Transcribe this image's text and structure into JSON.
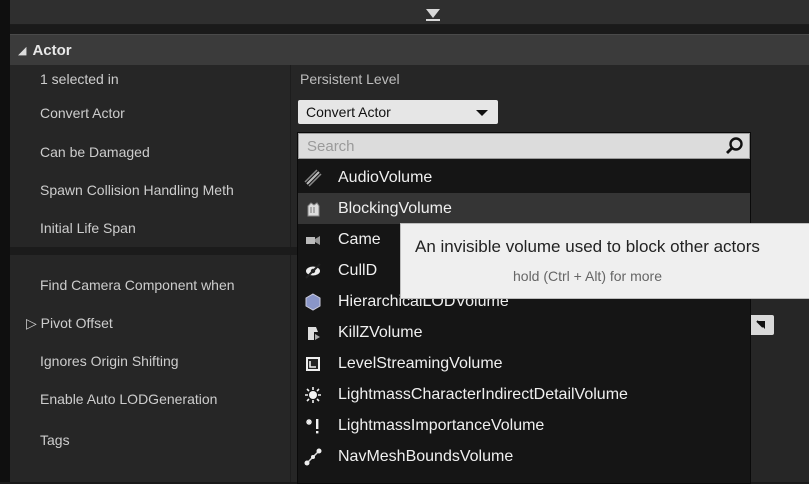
{
  "category": {
    "title": "Actor"
  },
  "rows": {
    "selected": {
      "label": "1 selected in",
      "value": "Persistent Level"
    },
    "convert_actor": {
      "label": "Convert Actor",
      "combo_value": "Convert Actor"
    },
    "can_be_damaged": {
      "label": "Can be Damaged"
    },
    "spawn_collision": {
      "label": "Spawn Collision Handling Meth"
    },
    "initial_life_span": {
      "label": "Initial Life Span"
    },
    "find_camera": {
      "label": "Find Camera Component when"
    },
    "pivot_offset": {
      "label": "Pivot Offset"
    },
    "ignores_origin": {
      "label": "Ignores Origin Shifting"
    },
    "auto_lod": {
      "label": "Enable Auto LODGeneration"
    },
    "tags": {
      "label": "Tags"
    }
  },
  "dropdown": {
    "search_placeholder": "Search",
    "items": [
      {
        "label": "AudioVolume",
        "icon": "audio-volume-icon"
      },
      {
        "label": "BlockingVolume",
        "icon": "blocking-volume-icon"
      },
      {
        "label": "Came",
        "icon": "camera-volume-icon"
      },
      {
        "label": "CullD",
        "icon": "cull-distance-volume-icon"
      },
      {
        "label": "HierarchicalLODVolume",
        "icon": "hlod-volume-icon"
      },
      {
        "label": "KillZVolume",
        "icon": "killz-volume-icon"
      },
      {
        "label": "LevelStreamingVolume",
        "icon": "level-streaming-volume-icon"
      },
      {
        "label": "LightmassCharacterIndirectDetailVolume",
        "icon": "lightmass-character-volume-icon"
      },
      {
        "label": "LightmassImportanceVolume",
        "icon": "lightmass-importance-volume-icon"
      },
      {
        "label": "NavMeshBoundsVolume",
        "icon": "navmesh-bounds-volume-icon"
      }
    ]
  },
  "tooltip": {
    "main": "An invisible volume used to block other actors",
    "sub": "hold (Ctrl + Alt) for more"
  }
}
